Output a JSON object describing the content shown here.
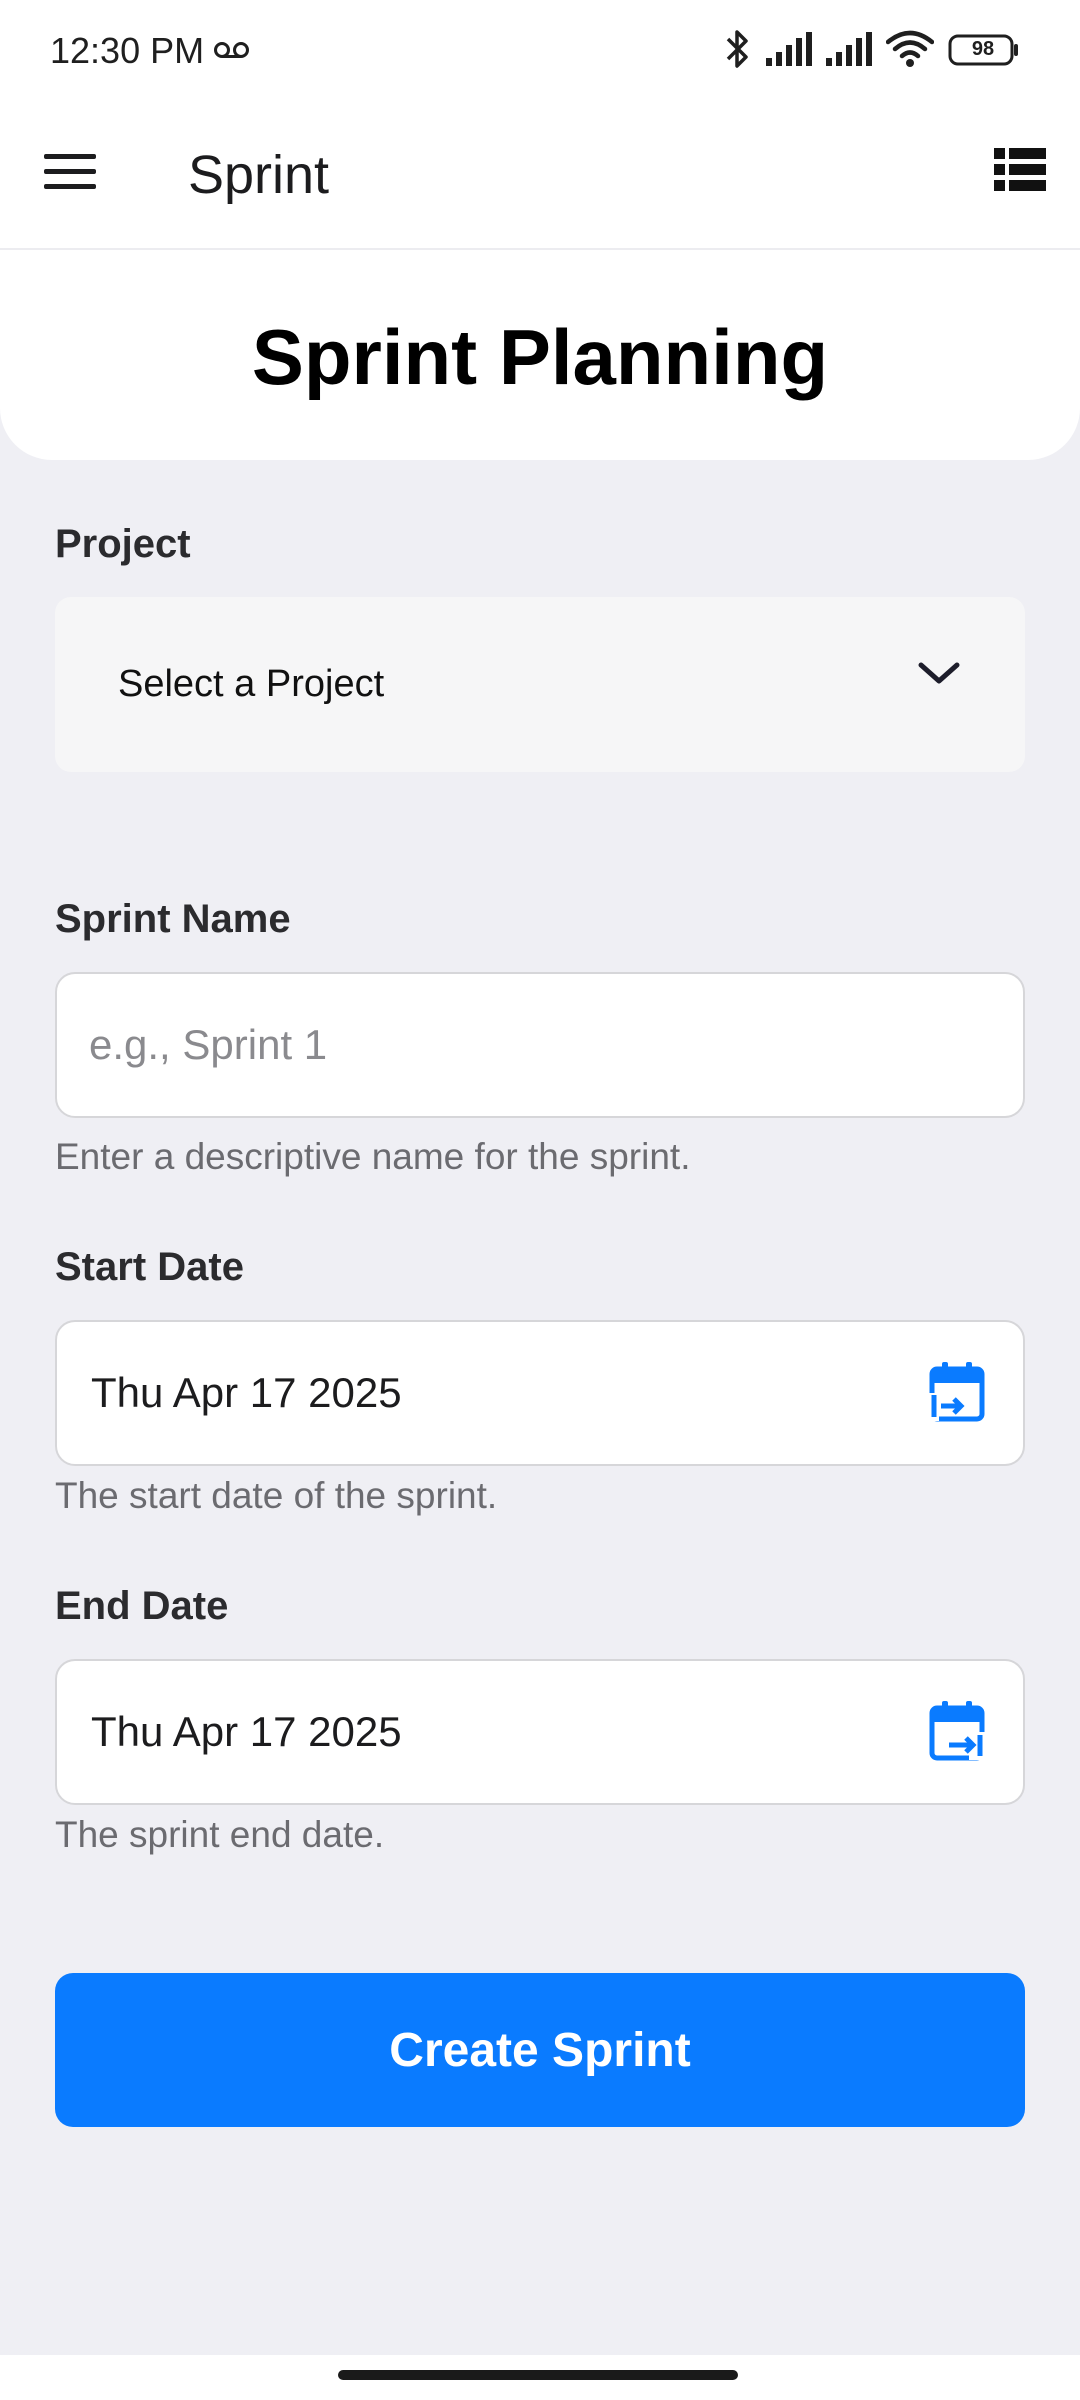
{
  "status_bar": {
    "time": "12:30 PM",
    "voicemail_icon": "voicemail-icon",
    "battery": "98",
    "icons": [
      "bluetooth-icon",
      "signal-icon",
      "signal-icon",
      "wifi-icon",
      "battery-icon"
    ]
  },
  "app_bar": {
    "title": "Sprint",
    "menu_icon": "menu-icon",
    "list_icon": "list-icon"
  },
  "header": {
    "title": "Sprint Planning"
  },
  "form": {
    "project": {
      "label": "Project",
      "selected_value": "Select a Project"
    },
    "sprint_name": {
      "label": "Sprint Name",
      "value": "",
      "placeholder": "e.g., Sprint 1",
      "helper": "Enter a descriptive name for the sprint."
    },
    "start_date": {
      "label": "Start Date",
      "value": "Thu Apr 17 2025",
      "helper": "The start date of the sprint."
    },
    "end_date": {
      "label": "End Date",
      "value": "Thu Apr 17 2025",
      "helper": "The sprint end date."
    },
    "submit_label": "Create Sprint"
  },
  "colors": {
    "primary": "#0a7bff",
    "background": "#efeff4",
    "surface": "#ffffff"
  }
}
